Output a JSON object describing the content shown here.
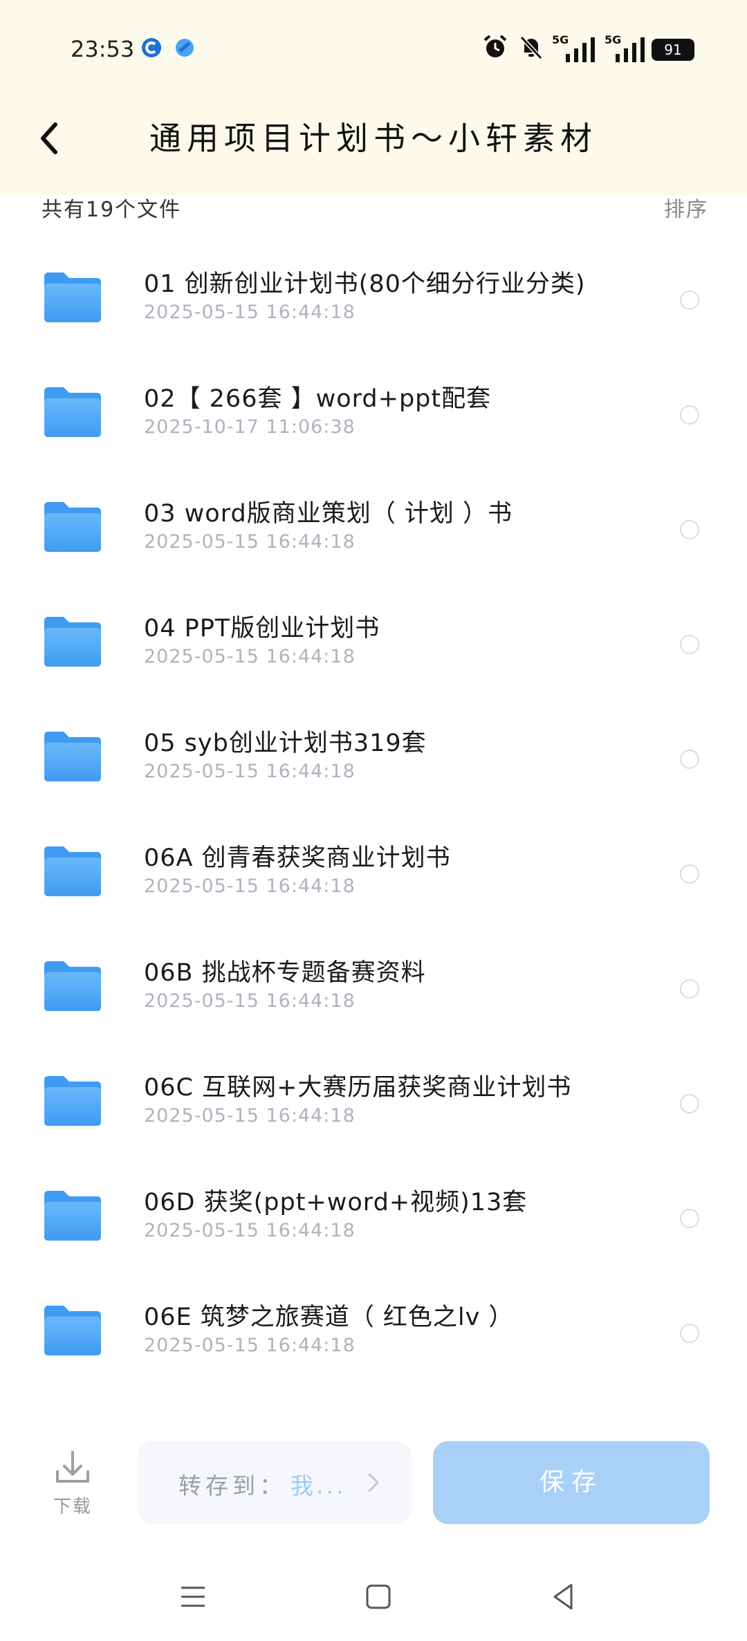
{
  "status_bar": {
    "time": "23:53",
    "icons": [
      "app-c-icon",
      "app-dot-icon",
      "alarm-icon",
      "mute-icon",
      "signal-5g-icon",
      "signal-5g-icon"
    ],
    "network_1": "5G",
    "network_2": "5G",
    "battery": "91"
  },
  "header": {
    "title": "通用项目计划书～小轩素材",
    "back_icon": "chevron-left-icon"
  },
  "summary": {
    "count_label": "共有19个文件",
    "sort_label": "排序"
  },
  "files": [
    {
      "name": "01 创新创业计划书(80个细分行业分类)",
      "date": "2025-05-15 16:44:18"
    },
    {
      "name": "02【 266套 】word+ppt配套",
      "date": "2025-10-17 11:06:38"
    },
    {
      "name": "03 word版商业策划（ 计划 ）书",
      "date": "2025-05-15 16:44:18"
    },
    {
      "name": "04 PPT版创业计划书",
      "date": "2025-05-15 16:44:18"
    },
    {
      "name": "05 syb创业计划书319套",
      "date": "2025-05-15 16:44:18"
    },
    {
      "name": "06A 创青春获奖商业计划书",
      "date": "2025-05-15 16:44:18"
    },
    {
      "name": "06B 挑战杯专题备赛资料",
      "date": "2025-05-15 16:44:18"
    },
    {
      "name": "06C 互联网+大赛历届获奖商业计划书",
      "date": "2025-05-15 16:44:18"
    },
    {
      "name": "06D 获奖(ppt+word+视频)13套",
      "date": "2025-05-15 16:44:18"
    },
    {
      "name": "06E 筑梦之旅赛道（ 红色之lv ）",
      "date": "2025-05-15 16:44:18"
    }
  ],
  "bottom_bar": {
    "download_label": "下载",
    "transfer_label": "转存到：",
    "transfer_target": "我...",
    "save_label": "保存"
  },
  "colors": {
    "header_bg": "#fcfaea",
    "folder_blue": "#4aa3f5",
    "save_bg": "#a9d0f7",
    "date_gray": "#aeb3bd"
  }
}
